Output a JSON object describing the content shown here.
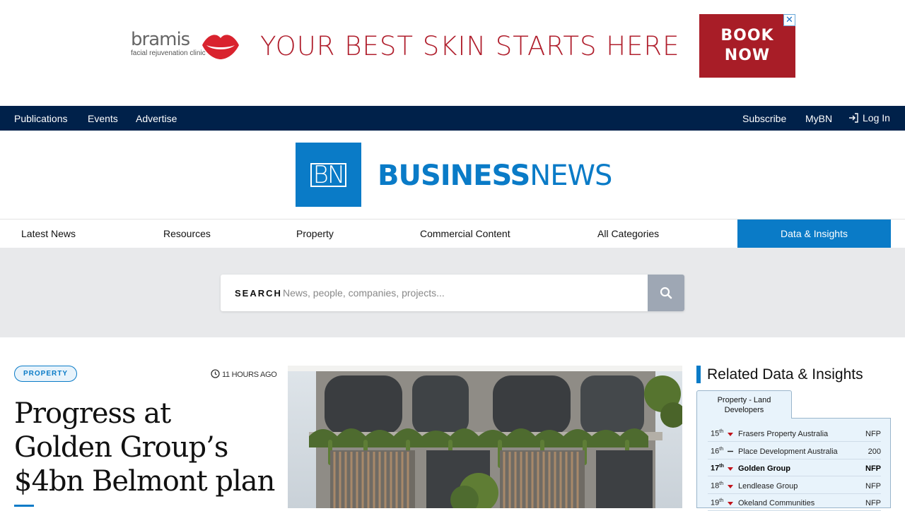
{
  "ad": {
    "brand": "bramis",
    "brand_sub": "facial rejuvenation clinic",
    "headline": "YOUR BEST SKIN STARTS HERE",
    "cta_line1": "BOOK",
    "cta_line2": "NOW",
    "close": "✕"
  },
  "topnav": {
    "publications": "Publications",
    "events": "Events",
    "advertise": "Advertise",
    "subscribe": "Subscribe",
    "mybn": "MyBN",
    "login": "Log In"
  },
  "logo": {
    "mark": "BN",
    "word_bold": "BUSINESS",
    "word_light": "NEWS"
  },
  "mainnav": {
    "latest": "Latest News",
    "resources": "Resources",
    "property": "Property",
    "commercial": "Commercial Content",
    "categories": "All Categories",
    "data": "Data & Insights"
  },
  "search": {
    "label": "SEARCH",
    "placeholder": "News, people, companies, projects..."
  },
  "article": {
    "tag": "PROPERTY",
    "time": "11 HOURS AGO",
    "headline": "Progress at Golden Group’s $4bn Belmont plan"
  },
  "sidebar": {
    "title": "Related Data & Insights",
    "tab": "Property - Land Developers",
    "rows": [
      {
        "rank": "15",
        "suffix": "th",
        "trend": "down",
        "name": "Frasers Property Australia",
        "value": "NFP"
      },
      {
        "rank": "16",
        "suffix": "th",
        "trend": "flat",
        "name": "Place Development Australia",
        "value": "200"
      },
      {
        "rank": "17",
        "suffix": "th",
        "trend": "down",
        "name": "Golden Group",
        "value": "NFP"
      },
      {
        "rank": "18",
        "suffix": "th",
        "trend": "down",
        "name": "Lendlease Group",
        "value": "NFP"
      },
      {
        "rank": "19",
        "suffix": "th",
        "trend": "down",
        "name": "Okeland Communities",
        "value": "NFP"
      }
    ]
  },
  "colors": {
    "navy": "#00214a",
    "brand_blue": "#0a7bc7",
    "ad_red": "#a81d27"
  }
}
